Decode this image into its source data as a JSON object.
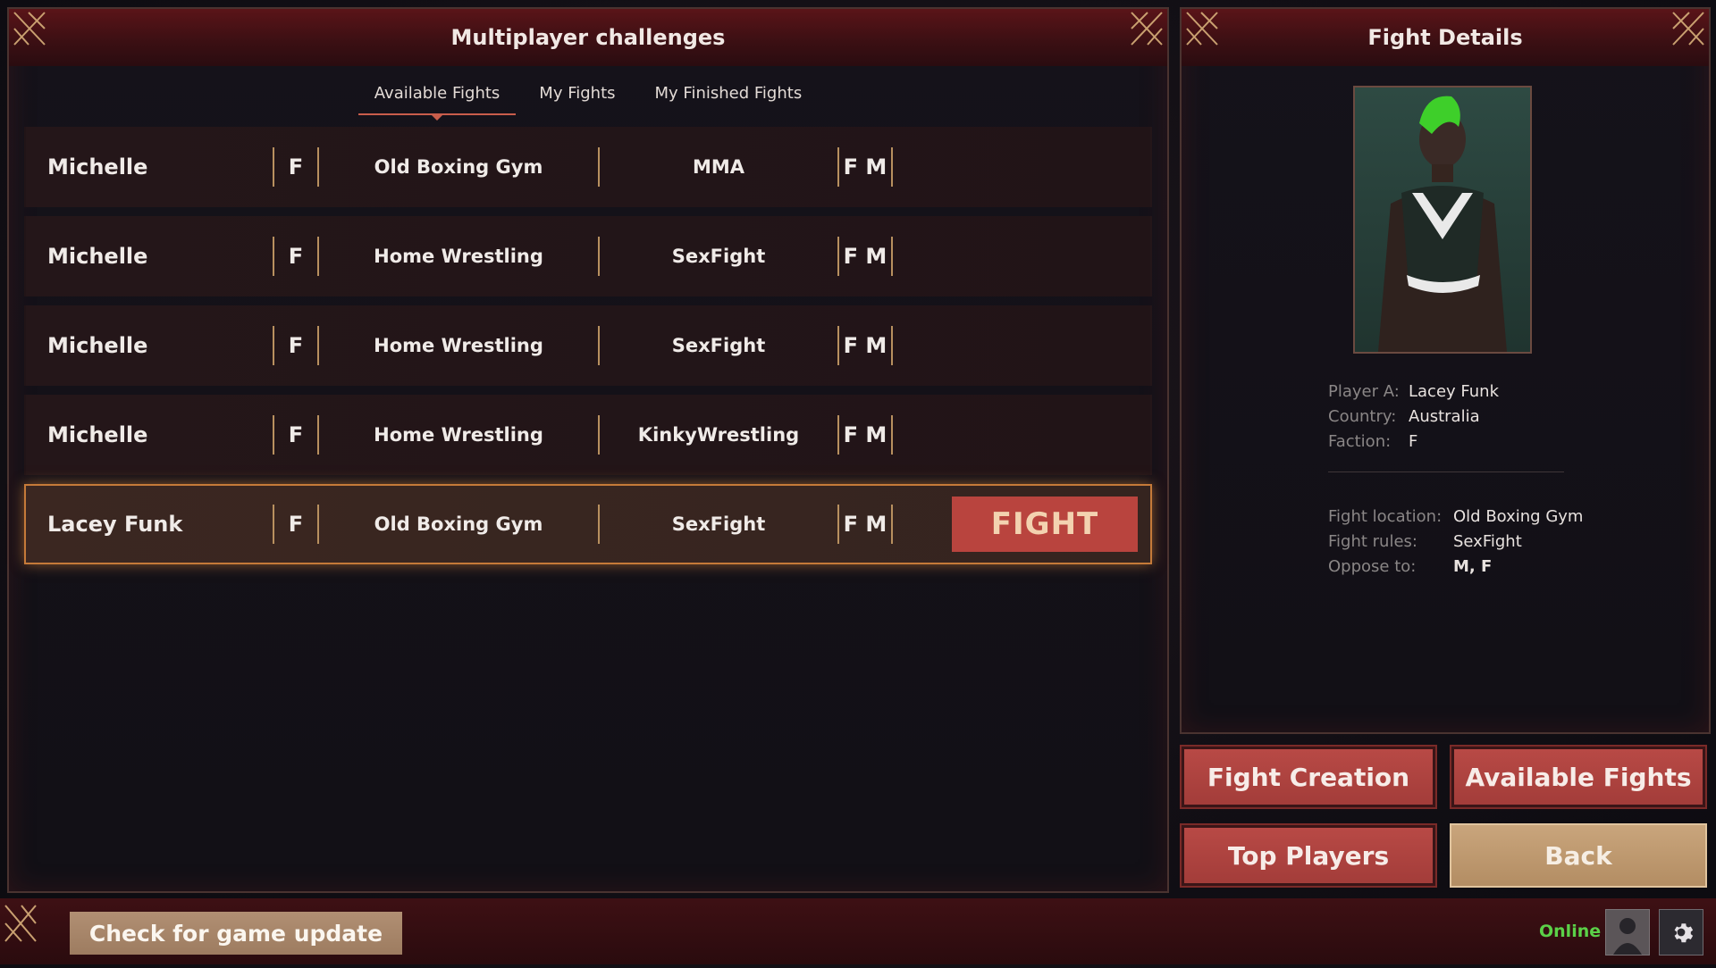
{
  "left_panel": {
    "title": "Multiplayer challenges",
    "tabs": [
      "Available Fights",
      "My Fights",
      "My Finished Fights"
    ],
    "active_tab": "Available Fights"
  },
  "fights": [
    {
      "name": "Michelle",
      "faction": "F",
      "location": "Old Boxing Gym",
      "rules": "MMA",
      "oppose": "F M"
    },
    {
      "name": "Michelle",
      "faction": "F",
      "location": "Home Wrestling",
      "rules": "SexFight",
      "oppose": "F M"
    },
    {
      "name": "Michelle",
      "faction": "F",
      "location": "Home Wrestling",
      "rules": "SexFight",
      "oppose": "F M"
    },
    {
      "name": "Michelle",
      "faction": "F",
      "location": "Home Wrestling",
      "rules": "KinkyWrestling",
      "oppose": "F M"
    },
    {
      "name": "Lacey Funk",
      "faction": "F",
      "location": "Old Boxing Gym",
      "rules": "SexFight",
      "oppose": "F M",
      "selected": true
    }
  ],
  "fight_button_label": "FIGHT",
  "details": {
    "title": "Fight Details",
    "player_a_label": "Player A:",
    "player_a": "Lacey Funk",
    "country_label": "Country:",
    "country": "Australia",
    "faction_label": "Faction:",
    "faction": "F",
    "location_label": "Fight location:",
    "location": "Old Boxing Gym",
    "rules_label": "Fight rules:",
    "rules": "SexFight",
    "oppose_label": "Oppose to:",
    "oppose": "M, F"
  },
  "buttons": {
    "fight_creation": "Fight Creation",
    "available_fights": "Available Fights",
    "top_players": "Top Players",
    "back": "Back"
  },
  "footer": {
    "update": "Check for game update",
    "status": "Online"
  },
  "colors": {
    "accent": "#b9443e",
    "online": "#5bd148",
    "selected_border": "#c57a39"
  },
  "icons": [
    "corner-ornament-icon",
    "avatar-icon",
    "gear-icon"
  ]
}
